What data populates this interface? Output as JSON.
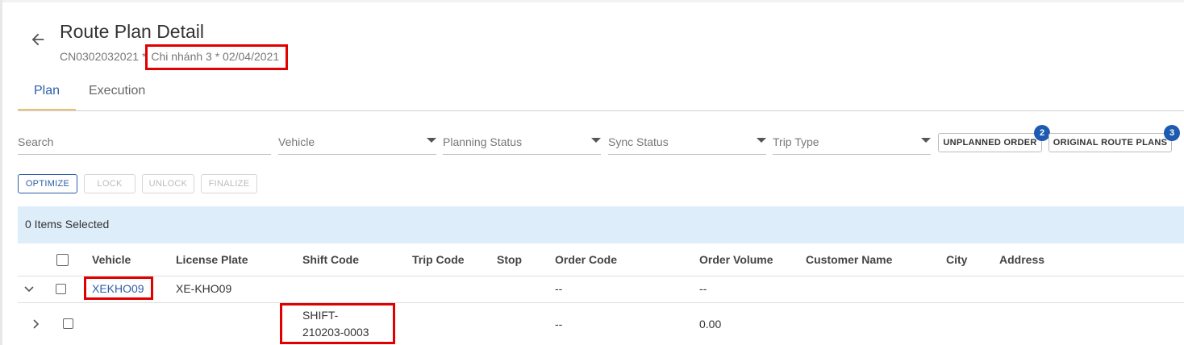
{
  "page": {
    "title": "Route Plan Detail",
    "code": "CN0302032021",
    "separator": " * ",
    "branch_date": "Chi nhánh 3 * 02/04/2021"
  },
  "tabs": [
    {
      "label": "Plan",
      "active": true
    },
    {
      "label": "Execution",
      "active": false
    }
  ],
  "filters": {
    "search_placeholder": "Search",
    "vehicle": "Vehicle",
    "planning_status": "Planning Status",
    "sync_status": "Sync Status",
    "trip_type": "Trip Type"
  },
  "buttons": {
    "unplanned_order": {
      "label": "UNPLANNED ORDER",
      "badge": "2"
    },
    "original_route_plans": {
      "label": "ORIGINAL ROUTE PLANS",
      "badge": "3"
    }
  },
  "actions": {
    "optimize": "OPTIMIZE",
    "lock": "LOCK",
    "unlock": "UNLOCK",
    "finalize": "FINALIZE"
  },
  "selection": {
    "text": "0 Items Selected"
  },
  "table": {
    "columns": [
      "Vehicle",
      "License Plate",
      "Shift Code",
      "Trip Code",
      "Stop",
      "Order Code",
      "Order Volume",
      "Customer Name",
      "City",
      "Address"
    ],
    "rows": [
      {
        "vehicle": "XEKHO09",
        "license_plate": "XE-KHO09",
        "shift_code": "",
        "trip_code": "",
        "stop": "",
        "order_code": "--",
        "order_volume": "--",
        "customer_name": "",
        "city": "",
        "address": ""
      },
      {
        "vehicle": "",
        "license_plate": "",
        "shift_code_line1": "SHIFT-",
        "shift_code_line2": "210203-0003",
        "trip_code": "",
        "stop": "",
        "order_code": "--",
        "order_volume": "0.00",
        "customer_name": "",
        "city": "",
        "address": ""
      }
    ]
  },
  "colors": {
    "accent": "#2e5ea8",
    "highlight": "#e00000",
    "selection_bg": "#deedfa",
    "badge": "#1e5bb0",
    "tab_underline": "#e8c27a"
  },
  "icons": [
    "arrow-left-icon",
    "chevron-down-icon",
    "chevron-right-icon",
    "caret-down-icon"
  ]
}
